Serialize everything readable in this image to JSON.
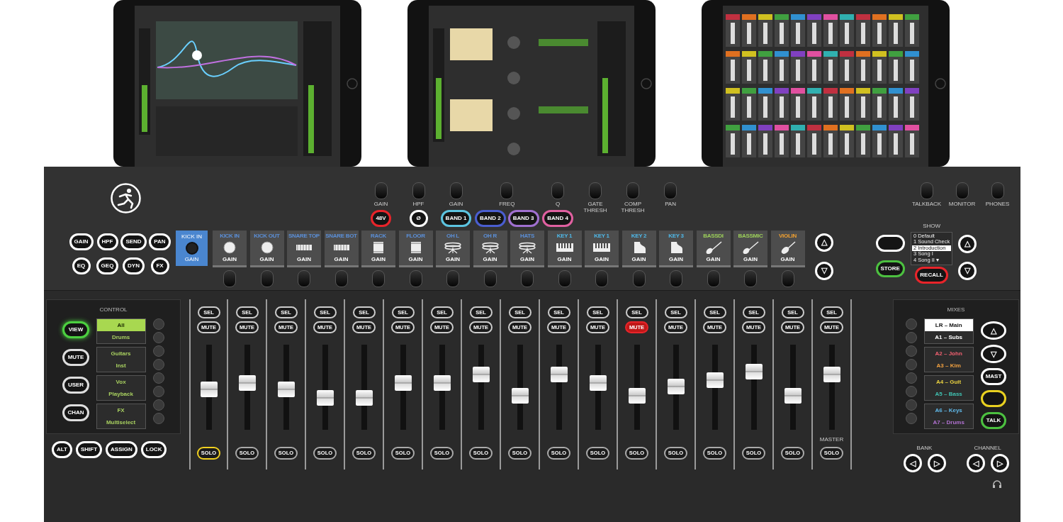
{
  "tablets": [
    {
      "kind": "eq"
    },
    {
      "kind": "dynamics"
    },
    {
      "kind": "mixer"
    }
  ],
  "knobs": [
    {
      "label": "GAIN",
      "buttons": [
        {
          "text": "48V",
          "color": "#e8242a"
        }
      ]
    },
    {
      "label": "HPF",
      "buttons": [
        {
          "text": "Ø",
          "color": "#ffffff"
        }
      ]
    },
    {
      "label": "GAIN",
      "buttons": [
        {
          "text": "BAND 1",
          "color": "#5cc4e0"
        }
      ]
    },
    {
      "label": "FREQ",
      "buttons": [
        {
          "text": "BAND 2",
          "color": "#4a5ed0"
        },
        {
          "text": "BAND 3",
          "color": "#a070d0"
        }
      ]
    },
    {
      "label": "Q",
      "buttons": [
        {
          "text": "BAND 4",
          "color": "#e060a0"
        }
      ]
    },
    {
      "label": "GATE THRESH"
    },
    {
      "label": "COMP THRESH"
    },
    {
      "label": "PAN"
    }
  ],
  "monitor_knobs": [
    "TALKBACK",
    "MONITOR",
    "PHONES"
  ],
  "function_buttons": [
    "GAIN",
    "HPF",
    "SEND",
    "PAN",
    "EQ",
    "GEQ",
    "DYN",
    "FX"
  ],
  "selected_channel": {
    "name": "KICK IN",
    "parameter": "GAIN"
  },
  "channels": [
    {
      "name": "KICK IN",
      "color": "#5b8fd8",
      "kind": "kick",
      "parameter": "GAIN"
    },
    {
      "name": "KICK OUT",
      "color": "#5b8fd8",
      "kind": "kick",
      "parameter": "GAIN"
    },
    {
      "name": "SNARE TOP",
      "color": "#5b8fd8",
      "kind": "snare",
      "parameter": "GAIN"
    },
    {
      "name": "SNARE BOT",
      "color": "#5b8fd8",
      "kind": "snare",
      "parameter": "GAIN"
    },
    {
      "name": "RACK",
      "color": "#5b8fd8",
      "kind": "tom",
      "parameter": "GAIN"
    },
    {
      "name": "FLOOR",
      "color": "#5b8fd8",
      "kind": "tom",
      "parameter": "GAIN"
    },
    {
      "name": "OH L",
      "color": "#5b8fd8",
      "kind": "cymbal",
      "parameter": "GAIN"
    },
    {
      "name": "OH R",
      "color": "#5b8fd8",
      "kind": "cymbal",
      "parameter": "GAIN"
    },
    {
      "name": "HATS",
      "color": "#5b8fd8",
      "kind": "cymbal",
      "parameter": "GAIN"
    },
    {
      "name": "KEY 1",
      "color": "#4fb8e8",
      "kind": "keys",
      "parameter": "GAIN"
    },
    {
      "name": "KEY 1",
      "color": "#4fb8e8",
      "kind": "keys",
      "parameter": "GAIN"
    },
    {
      "name": "KEY 2",
      "color": "#4fb8e8",
      "kind": "piano",
      "parameter": "GAIN"
    },
    {
      "name": "KEY 3",
      "color": "#4fb8e8",
      "kind": "piano",
      "parameter": "GAIN"
    },
    {
      "name": "BASSDI",
      "color": "#9ccf5a",
      "kind": "guitar",
      "parameter": "GAIN"
    },
    {
      "name": "BASSMIC",
      "color": "#9ccf5a",
      "kind": "guitar",
      "parameter": "GAIN"
    },
    {
      "name": "VIOLIN",
      "color": "#f0a030",
      "kind": "violin",
      "parameter": "GAIN"
    }
  ],
  "bank_arrows": {
    "up": "△",
    "down": "▽"
  },
  "show": {
    "title": "SHOW",
    "buttons": [
      {
        "color": "#ffffff"
      },
      {
        "text": "STORE",
        "color": "#4cc040"
      }
    ],
    "scenes": [
      {
        "label": "0 Default",
        "selected": false
      },
      {
        "label": "1 Sound Check",
        "selected": false
      },
      {
        "label": "2 Introduction",
        "selected": true
      },
      {
        "label": "3 Song I",
        "selected": false
      },
      {
        "label": "4 Song II ▾",
        "selected": false
      }
    ],
    "recall": {
      "text": "RECALL",
      "color": "#e8242a"
    },
    "up": "△",
    "down": "▽"
  },
  "control": {
    "title": "CONTROL",
    "buttons": [
      {
        "label": "VIEW",
        "lit": true
      },
      {
        "label": "MUTE",
        "lit": false
      },
      {
        "label": "USER",
        "lit": false
      },
      {
        "label": "CHAN",
        "lit": false
      }
    ],
    "groups": [
      {
        "label": "All",
        "selected": true
      },
      {
        "label": "Drums",
        "selected": false
      },
      {
        "label": "Guitars",
        "selected": false
      },
      {
        "label": "Inst",
        "selected": false
      },
      {
        "label": "Vox",
        "selected": false
      },
      {
        "label": "Playback",
        "selected": false
      },
      {
        "label": "FX",
        "selected": false
      },
      {
        "label": "Multiselect",
        "selected": false
      }
    ]
  },
  "strips": [
    {
      "sel": "SEL",
      "mute": "MUTE",
      "solo": "SOLO",
      "muted": false,
      "soloed": true,
      "level": 0.48
    },
    {
      "sel": "SEL",
      "mute": "MUTE",
      "solo": "SOLO",
      "muted": false,
      "soloed": false,
      "level": 0.57
    },
    {
      "sel": "SEL",
      "mute": "MUTE",
      "solo": "SOLO",
      "muted": false,
      "soloed": false,
      "level": 0.48
    },
    {
      "sel": "SEL",
      "mute": "MUTE",
      "solo": "SOLO",
      "muted": false,
      "soloed": false,
      "level": 0.35
    },
    {
      "sel": "SEL",
      "mute": "MUTE",
      "solo": "SOLO",
      "muted": false,
      "soloed": false,
      "level": 0.35
    },
    {
      "sel": "SEL",
      "mute": "MUTE",
      "solo": "SOLO",
      "muted": false,
      "soloed": false,
      "level": 0.57
    },
    {
      "sel": "SEL",
      "mute": "MUTE",
      "solo": "SOLO",
      "muted": false,
      "soloed": false,
      "level": 0.57
    },
    {
      "sel": "SEL",
      "mute": "MUTE",
      "solo": "SOLO",
      "muted": false,
      "soloed": false,
      "level": 0.7
    },
    {
      "sel": "SEL",
      "mute": "MUTE",
      "solo": "SOLO",
      "muted": false,
      "soloed": false,
      "level": 0.39
    },
    {
      "sel": "SEL",
      "mute": "MUTE",
      "solo": "SOLO",
      "muted": false,
      "soloed": false,
      "level": 0.7
    },
    {
      "sel": "SEL",
      "mute": "MUTE",
      "solo": "SOLO",
      "muted": false,
      "soloed": false,
      "level": 0.57
    },
    {
      "sel": "SEL",
      "mute": "MUTE",
      "solo": "SOLO",
      "muted": true,
      "soloed": false,
      "level": 0.39
    },
    {
      "sel": "SEL",
      "mute": "MUTE",
      "solo": "SOLO",
      "muted": false,
      "soloed": false,
      "level": 0.52
    },
    {
      "sel": "SEL",
      "mute": "MUTE",
      "solo": "SOLO",
      "muted": false,
      "soloed": false,
      "level": 0.61
    },
    {
      "sel": "SEL",
      "mute": "MUTE",
      "solo": "SOLO",
      "muted": false,
      "soloed": false,
      "level": 0.74
    },
    {
      "sel": "SEL",
      "mute": "MUTE",
      "solo": "SOLO",
      "muted": false,
      "soloed": false,
      "level": 0.39
    }
  ],
  "master": {
    "label": "MASTER",
    "sel": "SEL",
    "mute": "MUTE",
    "solo": "SOLO",
    "level": 0.7
  },
  "mixes": {
    "title": "MIXES",
    "items": [
      {
        "label": "LR – Main",
        "color": "#ffffff",
        "selected": true
      },
      {
        "label": "A1 – Subs",
        "color": "#ffffff",
        "selected": false
      },
      {
        "label": "A2 – John",
        "color": "#f06070",
        "selected": false
      },
      {
        "label": "A3 – Kim",
        "color": "#f0a040",
        "selected": false
      },
      {
        "label": "A4 – Guit",
        "color": "#e8d040",
        "selected": false
      },
      {
        "label": "A5 – Bass",
        "color": "#40c0b0",
        "selected": false
      },
      {
        "label": "A6 – Keys",
        "color": "#60b8e8",
        "selected": false
      },
      {
        "label": "A7 – Drums",
        "color": "#b070d0",
        "selected": false
      }
    ],
    "buttons": [
      {
        "text": "△",
        "color": "#ffffff"
      },
      {
        "text": "▽",
        "color": "#ffffff"
      },
      {
        "text": "MAST",
        "color": "#ffffff"
      },
      {
        "color": "#e8d020"
      },
      {
        "text": "TALK",
        "color": "#4cc040"
      }
    ]
  },
  "footer_buttons": [
    "ALT",
    "SHIFT",
    "ASSIGN",
    "LOCK"
  ],
  "bank": {
    "label": "BANK",
    "left": "◁",
    "right": "▷"
  },
  "channel_nav": {
    "label": "CHANNEL",
    "left": "◁",
    "right": "▷"
  }
}
